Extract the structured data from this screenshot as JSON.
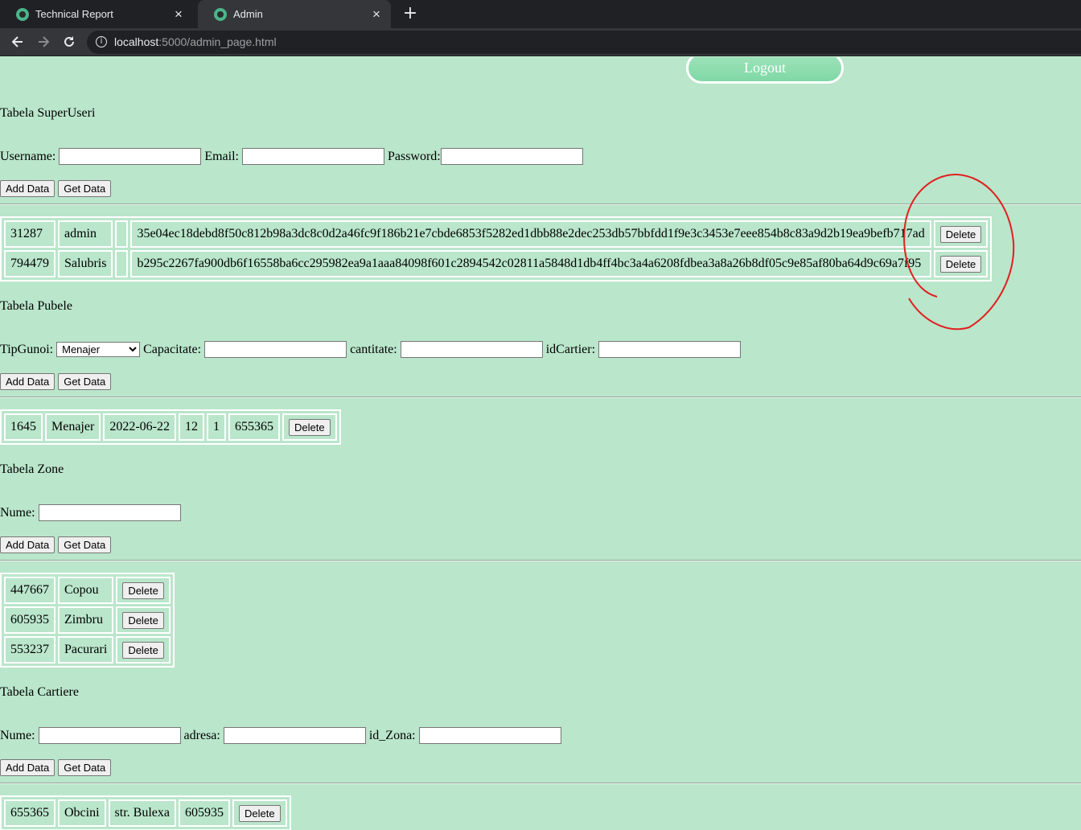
{
  "browser": {
    "tabs": [
      {
        "title": "Technical Report",
        "active": false
      },
      {
        "title": "Admin",
        "active": true
      }
    ],
    "close_glyph": "×",
    "new_tab_glyph": "+",
    "url_host": "localhost",
    "url_path": ":5000/admin_page.html",
    "icons": {
      "back": "arrow-left-icon",
      "forward": "arrow-right-icon",
      "reload": "reload-icon",
      "info": "info-icon"
    }
  },
  "logout_label": "Logout",
  "superuseri": {
    "title": "Tabela SuperUseri",
    "labels": {
      "username": "Username:",
      "email": "Email:",
      "password": "Password:"
    },
    "values": {
      "username": "",
      "email": "",
      "password": ""
    },
    "add_label": "Add Data",
    "get_label": "Get Data",
    "rows": [
      {
        "id": "31287",
        "username": "admin",
        "email": "",
        "password": "35e04ec18debd8f50c812b98a3dc8c0d2a46fc9f186b21e7cbde6853f5282ed1dbb88e2dec253db57bbfdd1f9e3c3453e7eee854b8c83a9d2b19ea9befb717ad",
        "delete_label": "Delete"
      },
      {
        "id": "794479",
        "username": "Salubris",
        "email": "",
        "password": "b295c2267fa900db6f16558ba6cc295982ea9a1aaa84098f601c2894542c02811a5848d1db4ff4bc3a4a6208fdbea3a8a26b8df05c9e85af80ba64d9c69a7f95",
        "delete_label": "Delete"
      }
    ]
  },
  "pubele": {
    "title": "Tabela Pubele",
    "labels": {
      "tip_gunoi": "TipGunoi:",
      "capacitate": "Capacitate:",
      "cantitate": "cantitate:",
      "id_cartier": "idCartier:"
    },
    "tip_gunoi_selected": "Menajer",
    "values": {
      "capacitate": "",
      "cantitate": "",
      "id_cartier": ""
    },
    "add_label": "Add Data",
    "get_label": "Get Data",
    "rows": [
      {
        "id": "1645",
        "tip": "Menajer",
        "data": "2022-06-22",
        "capacitate": "12",
        "cantitate": "1",
        "id_cartier": "655365",
        "delete_label": "Delete"
      }
    ]
  },
  "zone": {
    "title": "Tabela Zone",
    "labels": {
      "nume": "Nume:"
    },
    "values": {
      "nume": ""
    },
    "add_label": "Add Data",
    "get_label": "Get Data",
    "rows": [
      {
        "id": "447667",
        "nume": "Copou",
        "delete_label": "Delete"
      },
      {
        "id": "605935",
        "nume": "Zimbru",
        "delete_label": "Delete"
      },
      {
        "id": "553237",
        "nume": "Pacurari",
        "delete_label": "Delete"
      }
    ]
  },
  "cartiere": {
    "title": "Tabela Cartiere",
    "labels": {
      "nume": "Nume:",
      "adresa": "adresa:",
      "id_zona": "id_Zona:"
    },
    "values": {
      "nume": "",
      "adresa": "",
      "id_zona": ""
    },
    "add_label": "Add Data",
    "get_label": "Get Data",
    "rows": [
      {
        "id": "655365",
        "nume": "Obcini",
        "adresa": "str. Bulexa",
        "id_zona": "605935",
        "delete_label": "Delete"
      }
    ]
  },
  "colors": {
    "page_bg": "#bae6cb",
    "annotation": "#e02020",
    "tab_bar": "#202124"
  }
}
